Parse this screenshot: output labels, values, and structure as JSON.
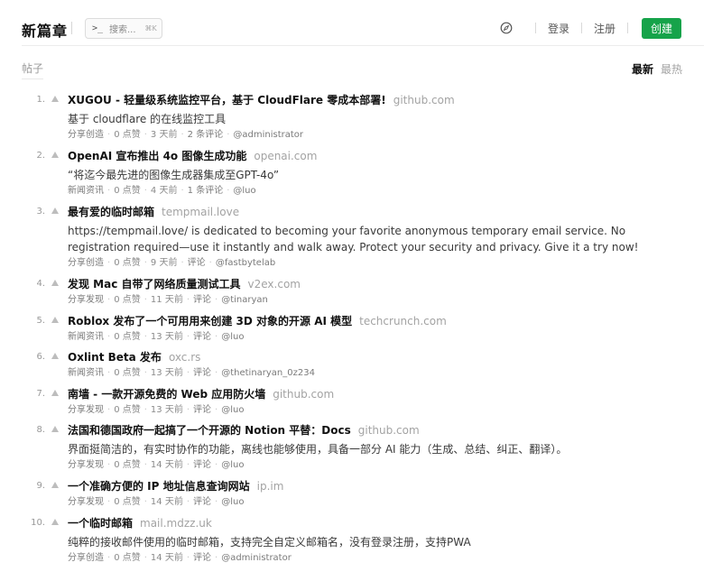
{
  "header": {
    "brand": "新篇章",
    "search_label": "搜索...",
    "search_shortcut": "⌘K",
    "login": "登录",
    "register": "注册",
    "create": "创建",
    "accent_color": "#16a34a"
  },
  "subbar": {
    "tab_label": "帖子",
    "sort_latest": "最新",
    "sort_hot": "最热"
  },
  "posts": [
    {
      "rank": "1.",
      "title": "XUGOU - 轻量级系统监控平台，基于 CloudFlare 零成本部署!",
      "domain": "github.com",
      "desc": "基于 cloudflare 的在线监控工具",
      "category": "分享创造",
      "likes": "0 点赞",
      "time": "3 天前",
      "comments": "2 条评论",
      "author": "@administrator"
    },
    {
      "rank": "2.",
      "title": "OpenAI 宣布推出 4o 图像生成功能",
      "domain": "openai.com",
      "desc": "“将迄今最先进的图像生成器集成至GPT-4o”",
      "category": "新闻资讯",
      "likes": "0 点赞",
      "time": "4 天前",
      "comments": "1 条评论",
      "author": "@luo"
    },
    {
      "rank": "3.",
      "title": "最有爱的临时邮箱",
      "domain": "tempmail.love",
      "desc": "https://tempmail.love/ is dedicated to becoming your favorite anonymous temporary email service. No registration required—use it instantly and walk away. Protect your security and privacy. Give it a try now!",
      "category": "分享创造",
      "likes": "0 点赞",
      "time": "9 天前",
      "comments": "评论",
      "author": "@fastbytelab"
    },
    {
      "rank": "4.",
      "title": "发现 Mac 自带了网络质量测试工具",
      "domain": "v2ex.com",
      "desc": "",
      "category": "分享发现",
      "likes": "0 点赞",
      "time": "11 天前",
      "comments": "评论",
      "author": "@tinaryan"
    },
    {
      "rank": "5.",
      "title": "Roblox 发布了一个可用用来创建 3D 对象的开源 AI 模型",
      "domain": "techcrunch.com",
      "desc": "",
      "category": "新闻资讯",
      "likes": "0 点赞",
      "time": "13 天前",
      "comments": "评论",
      "author": "@luo"
    },
    {
      "rank": "6.",
      "title": "Oxlint Beta 发布",
      "domain": "oxc.rs",
      "desc": "",
      "category": "新闻资讯",
      "likes": "0 点赞",
      "time": "13 天前",
      "comments": "评论",
      "author": "@thetinaryan_0z234"
    },
    {
      "rank": "7.",
      "title": "南墙 - 一款开源免费的 Web 应用防火墙",
      "domain": "github.com",
      "desc": "",
      "category": "分享发现",
      "likes": "0 点赞",
      "time": "13 天前",
      "comments": "评论",
      "author": "@luo"
    },
    {
      "rank": "8.",
      "title": "法国和德国政府一起搞了一个开源的 Notion 平替：Docs",
      "domain": "github.com",
      "desc": "界面挺简洁的，有实时协作的功能，离线也能够使用，具备一部分 AI 能力（生成、总结、纠正、翻译）。",
      "category": "分享发现",
      "likes": "0 点赞",
      "time": "14 天前",
      "comments": "评论",
      "author": "@luo"
    },
    {
      "rank": "9.",
      "title": "一个准确方便的 IP 地址信息查询网站",
      "domain": "ip.im",
      "desc": "",
      "category": "分享发现",
      "likes": "0 点赞",
      "time": "14 天前",
      "comments": "评论",
      "author": "@luo"
    },
    {
      "rank": "10.",
      "title": "一个临时邮箱",
      "domain": "mail.mdzz.uk",
      "desc": "纯粹的接收邮件使用的临时邮箱，支持完全自定义邮箱名，没有登录注册，支持PWA",
      "category": "分享创造",
      "likes": "0 点赞",
      "time": "14 天前",
      "comments": "评论",
      "author": "@administrator"
    }
  ]
}
